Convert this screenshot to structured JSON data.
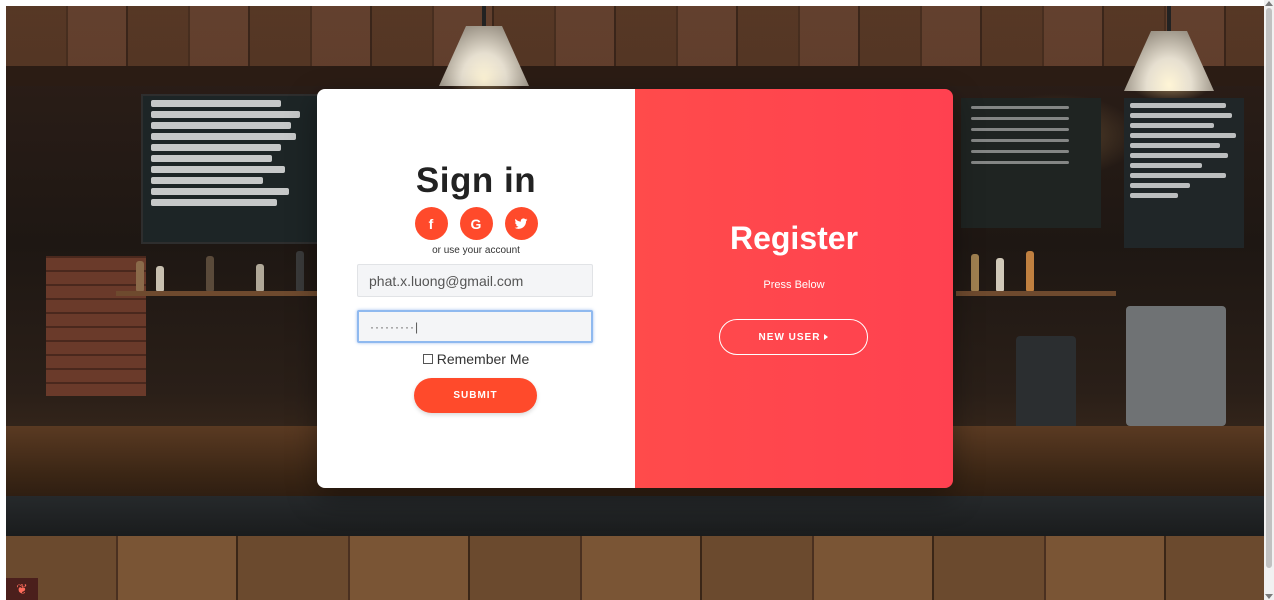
{
  "signin": {
    "title": "Sign in",
    "social_buttons": [
      {
        "icon": "facebook-icon",
        "glyph": "f"
      },
      {
        "icon": "google-icon",
        "glyph": "G"
      },
      {
        "icon": "twitter-icon",
        "glyph": ""
      }
    ],
    "alt_text": "or use your account",
    "email_value": "phat.x.luong@gmail.com",
    "password_value": "·········|",
    "remember_label": "Remember Me",
    "remember_checked": false,
    "submit_label": "SUBMIT"
  },
  "register": {
    "title": "Register",
    "subtitle": "Press Below",
    "new_user_label": "NEW USER"
  },
  "colors": {
    "accent": "#ff4a2b",
    "register_bg": "#ff4b4b",
    "card_bg": "#ffffff"
  }
}
